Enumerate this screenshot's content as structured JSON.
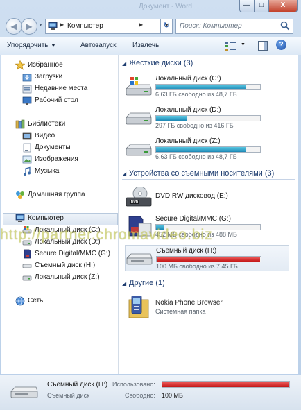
{
  "window": {
    "ghost_title": "Документ - Word",
    "min_label": "—",
    "max_label": "□",
    "close_label": "X"
  },
  "address_bar": {
    "path": "Компьютер",
    "search_placeholder": "Поиск: Компьютер"
  },
  "toolbar": {
    "organize": "Упорядочить",
    "autoplay": "Автозапуск",
    "eject": "Извлечь",
    "help": "?"
  },
  "nav_pane": {
    "favorites": "Избранное",
    "downloads": "Загрузки",
    "recent": "Недавние места",
    "desktop": "Рабочий стол",
    "libraries": "Библиотеки",
    "video": "Видео",
    "documents": "Документы",
    "images": "Изображения",
    "music": "Музыка",
    "homegroup": "Домашняя группа",
    "computer": "Компьютер",
    "local_c": "Локальный диск (C:)",
    "local_d": "Локальный диск (D:)",
    "sd_g": "Secure Digital/MMC (G:)",
    "removable_h": "Съемный диск (H:)",
    "local_z": "Локальный диск (Z:)",
    "network": "Сеть"
  },
  "content": {
    "group_hdd": "Жесткие диски (3)",
    "group_removable": "Устройства со съемными носителями (3)",
    "group_other": "Другие (1)",
    "drives": {
      "c": {
        "name": "Локальный диск (C:)",
        "info": "6,63 ГБ свободно из 48,7 ГБ",
        "used_fraction": 0.86
      },
      "d": {
        "name": "Локальный диск (D:)",
        "info": "297 ГБ свободно из 416 ГБ",
        "used_fraction": 0.29
      },
      "z": {
        "name": "Локальный диск (Z:)",
        "info": "6,63 ГБ свободно из 48,7 ГБ",
        "used_fraction": 0.86
      },
      "e": {
        "name": "DVD RW дисковод (E:)"
      },
      "g": {
        "name": "Secure Digital/MMC (G:)",
        "info": "452 МБ свободно из 488 МБ",
        "used_fraction": 0.07
      },
      "h": {
        "name": "Съемный диск (H:)",
        "info": "100 МБ свободно из 7,45 ГБ",
        "used_fraction": 0.99
      }
    },
    "other_item": {
      "name": "Nokia Phone Browser",
      "type": "Системная папка"
    }
  },
  "watermark": "http://partner.chromavideo.biz",
  "status_bar": {
    "name": "Съемный диск (H:)",
    "type": "Съемный диск",
    "used_label": "Использовано:",
    "free_label": "Свободно:",
    "free_value": "100 МБ"
  }
}
